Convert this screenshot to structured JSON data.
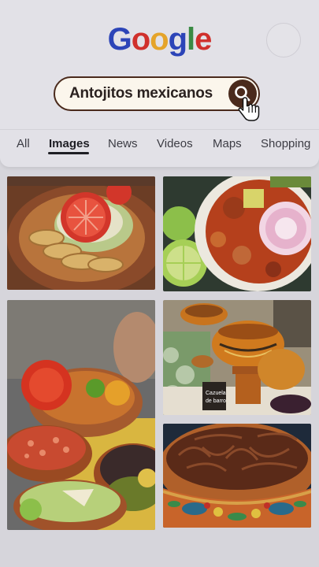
{
  "logo": {
    "letters": [
      {
        "char": "G",
        "color": "#2c44b8"
      },
      {
        "char": "o",
        "color": "#d0302c"
      },
      {
        "char": "o",
        "color": "#e5a42a"
      },
      {
        "char": "g",
        "color": "#2c44b8"
      },
      {
        "char": "l",
        "color": "#3a8a44"
      },
      {
        "char": "e",
        "color": "#d0302c"
      }
    ]
  },
  "search": {
    "query": "Antojitos mexicanos"
  },
  "tabs": [
    {
      "label": "All"
    },
    {
      "label": "Images"
    },
    {
      "label": "News"
    },
    {
      "label": "Videos"
    },
    {
      "label": "Maps"
    },
    {
      "label": "Shopping"
    }
  ],
  "results": [
    {
      "subject": "flautas with tomato and lettuce"
    },
    {
      "subject": "pozole red soup with lime"
    },
    {
      "subject": "bowls of salsa and guacamole"
    },
    {
      "subject": "clay pots market stall"
    },
    {
      "subject": "shredded meat in painted clay bowl"
    }
  ],
  "colors": {
    "accent": "#4a2a1c",
    "search_bg": "#fbf6ec"
  }
}
